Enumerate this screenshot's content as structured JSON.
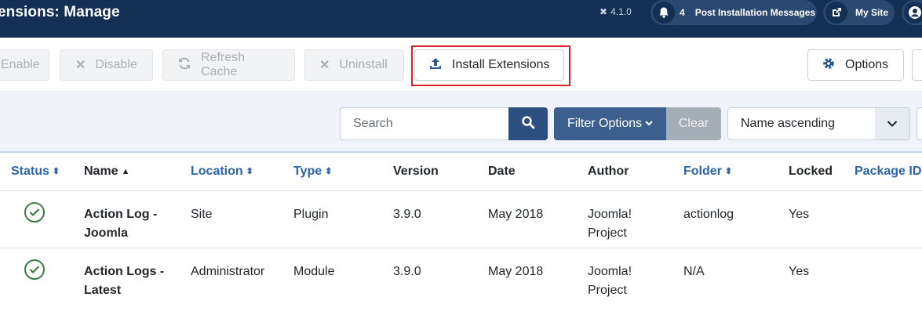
{
  "header": {
    "title": "ensions: Manage",
    "version": "4.1.0",
    "messages_count": "4",
    "messages_label": "Post Installation Messages",
    "site_label": "My Site"
  },
  "toolbar": {
    "enable_label": "Enable",
    "disable_label": "Disable",
    "refresh_label": "Refresh Cache",
    "uninstall_label": "Uninstall",
    "install_label": "Install Extensions",
    "options_label": "Options"
  },
  "filters": {
    "search_placeholder": "Search",
    "filter_options_label": "Filter Options",
    "clear_label": "Clear",
    "sort_value": "Name ascending"
  },
  "table": {
    "columns": {
      "status": "Status",
      "name": "Name",
      "location": "Location",
      "type": "Type",
      "version": "Version",
      "date": "Date",
      "author": "Author",
      "folder": "Folder",
      "locked": "Locked",
      "package_id": "Package ID"
    },
    "rows": [
      {
        "name_line1": "Action Log -",
        "name_line2": "Joomla",
        "location": "Site",
        "type": "Plugin",
        "version": "3.9.0",
        "date": "May 2018",
        "author_line1": "Joomla!",
        "author_line2": "Project",
        "folder": "actionlog",
        "locked": "Yes"
      },
      {
        "name_line1": "Action Logs -",
        "name_line2": "Latest",
        "location": "Administrator",
        "type": "Module",
        "version": "3.9.0",
        "date": "May 2018",
        "author_line1": "Joomla!",
        "author_line2": "Project",
        "folder": "N/A",
        "locked": "Yes"
      }
    ]
  },
  "colors": {
    "header_bg": "#132f53",
    "accent": "#2d63a8",
    "highlight": "#d6222a",
    "status_ok": "#3d7a4a"
  }
}
